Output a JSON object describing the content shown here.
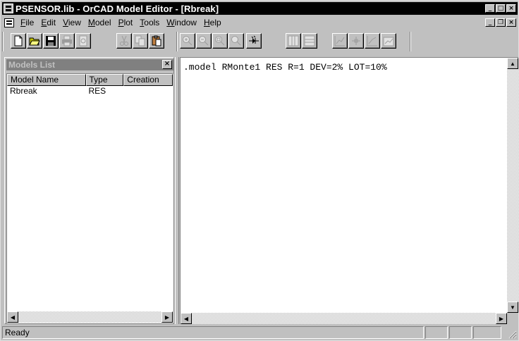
{
  "window": {
    "title": "PSENSOR.lib - OrCAD Model Editor - [Rbreak]"
  },
  "title_controls": [
    "minimize-icon",
    "maximize-icon",
    "close-icon"
  ],
  "menu": {
    "items": [
      {
        "label": "File",
        "mnemonic": "F",
        "rest": "ile"
      },
      {
        "label": "Edit",
        "mnemonic": "E",
        "rest": "dit"
      },
      {
        "label": "View",
        "mnemonic": "V",
        "rest": "iew"
      },
      {
        "label": "Model",
        "mnemonic": "M",
        "rest": "odel"
      },
      {
        "label": "Plot",
        "mnemonic": "P",
        "rest": "lot"
      },
      {
        "label": "Tools",
        "mnemonic": "T",
        "rest": "ools"
      },
      {
        "label": "Window",
        "mnemonic": "W",
        "rest": "indow"
      },
      {
        "label": "Help",
        "mnemonic": "H",
        "rest": "elp"
      }
    ]
  },
  "toolbar": {
    "groups": [
      [
        "new-file-icon",
        "open-folder-icon",
        "save-icon",
        "print-icon",
        "print-preview-icon"
      ],
      [
        "cut-icon",
        "copy-icon",
        "paste-icon"
      ],
      [
        "zoom-in-icon",
        "zoom-out-icon",
        "zoom-area-icon",
        "zoom-fit-icon"
      ],
      [
        "diode-icon"
      ],
      [
        "vertical-split-icon",
        "horizontal-split-icon"
      ],
      [
        "add-trace-icon",
        "cursor-icon",
        "extract-icon",
        "edit-curve-icon"
      ]
    ]
  },
  "models_list": {
    "title": "Models List",
    "columns": [
      "Model Name",
      "Type",
      "Creation"
    ],
    "rows": [
      {
        "name": "Rbreak",
        "type": "RES",
        "creation": ""
      }
    ]
  },
  "editor": {
    "content": ".model RMonte1 RES R=1 DEV=2% LOT=10%"
  },
  "status": {
    "text": "Ready"
  }
}
